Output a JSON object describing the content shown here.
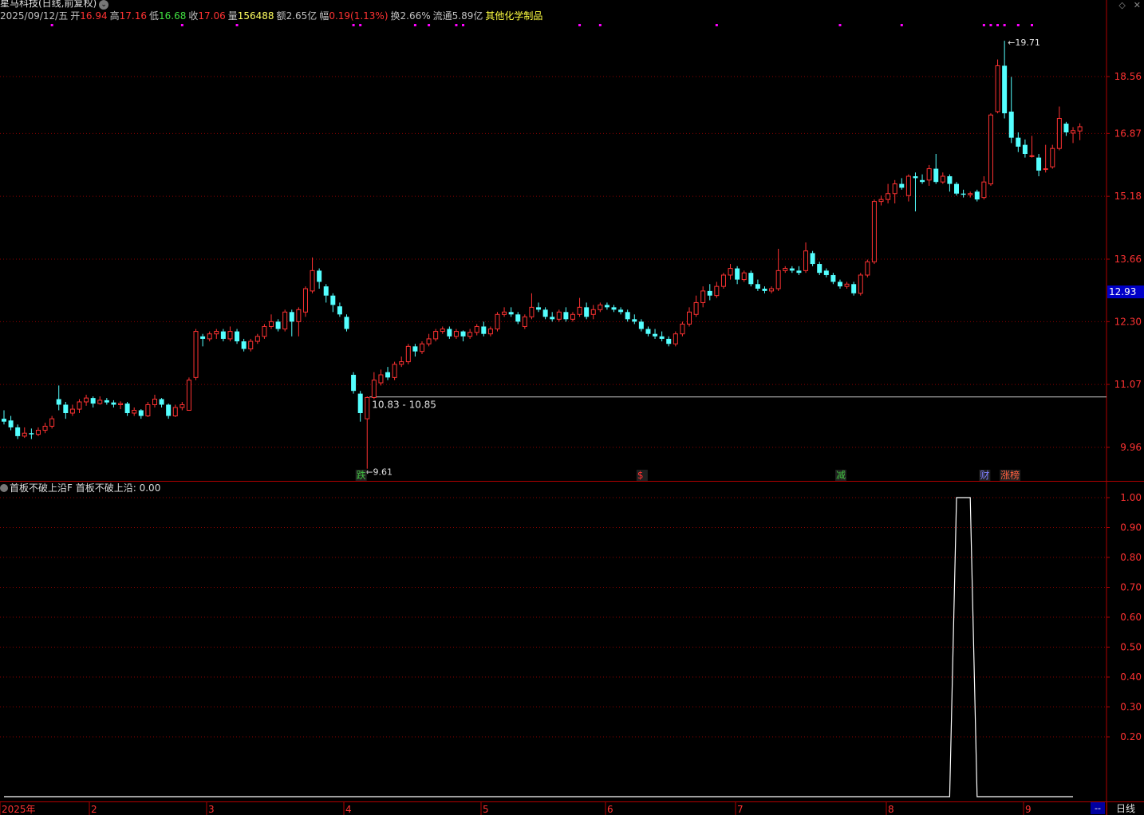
{
  "header": {
    "title": "星马科技(日线,前复权)",
    "date": "2025/09/12/五",
    "open_label": "开",
    "open": "16.94",
    "high_label": "高",
    "high": "17.16",
    "low_label": "低",
    "low": "16.68",
    "close_label": "收",
    "close": "17.06",
    "volume_label": "量",
    "volume": "156488",
    "amount_label": "额",
    "amount": "2.65亿",
    "change_label": "幅",
    "change": "0.19(1.13%)",
    "turnover_label": "换",
    "turnover": "2.66%",
    "float_label": "流通",
    "float": "5.89亿",
    "industry": "其他化学制品"
  },
  "window_icons": [
    "diamond-icon",
    "close-icon"
  ],
  "indicator": {
    "name": "首板不破上沿F",
    "value_label": "首板不破上沿:",
    "value": "0.00"
  },
  "period_tab": "日线",
  "period_dash": "--",
  "colors": {
    "up": "#ff3232",
    "down": "#54ffff",
    "grid": "#8b0000",
    "axis_text": "#ff3232",
    "current_price_bg": "#0000c8",
    "indicator_line": "#ffffff",
    "marker": "#ff00ff"
  },
  "chart_data": [
    {
      "type": "candlestick",
      "y_ticks": [
        "18.56",
        "16.87",
        "15.18",
        "13.66",
        "12.30",
        "11.07",
        "9.96"
      ],
      "current_price": "12.93",
      "high_annotation": "19.71",
      "low_annotation": "9.61",
      "range_annotation": "10.83 - 10.85",
      "x_ticks": [
        "2025年",
        "2",
        "3",
        "4",
        "5",
        "6",
        "7",
        "8",
        "9"
      ],
      "event_tags": [
        {
          "text": "跌",
          "color": "#40c040"
        },
        {
          "text": "$",
          "color": "#ff3232"
        },
        {
          "text": "减",
          "color": "#40c040"
        },
        {
          "text": "财",
          "color": "#8080ff"
        },
        {
          "text": "涨榜",
          "color": "#ff6040"
        }
      ],
      "candles": [
        [
          10.45,
          10.4,
          10.6,
          10.35
        ],
        [
          10.42,
          10.3,
          10.5,
          10.25
        ],
        [
          10.3,
          10.15,
          10.35,
          10.1
        ],
        [
          10.15,
          10.2,
          10.3,
          10.12
        ],
        [
          10.2,
          10.18,
          10.28,
          10.1
        ],
        [
          10.18,
          10.25,
          10.3,
          10.15
        ],
        [
          10.25,
          10.32,
          10.38,
          10.2
        ],
        [
          10.32,
          10.45,
          10.5,
          10.28
        ],
        [
          10.8,
          10.7,
          11.05,
          10.6
        ],
        [
          10.7,
          10.55,
          10.75,
          10.45
        ],
        [
          10.55,
          10.62,
          10.7,
          10.5
        ],
        [
          10.62,
          10.75,
          10.8,
          10.55
        ],
        [
          10.75,
          10.82,
          10.88,
          10.68
        ],
        [
          10.82,
          10.72,
          10.85,
          10.65
        ],
        [
          10.72,
          10.78,
          10.85,
          10.7
        ],
        [
          10.78,
          10.74,
          10.82,
          10.7
        ],
        [
          10.74,
          10.7,
          10.78,
          10.65
        ],
        [
          10.7,
          10.72,
          10.76,
          10.62
        ],
        [
          10.72,
          10.55,
          10.75,
          10.5
        ],
        [
          10.55,
          10.6,
          10.65,
          10.5
        ],
        [
          10.6,
          10.5,
          10.62,
          10.45
        ],
        [
          10.5,
          10.7,
          10.75,
          10.48
        ],
        [
          10.7,
          10.8,
          10.88,
          10.65
        ],
        [
          10.8,
          10.7,
          10.82,
          10.65
        ],
        [
          10.7,
          10.5,
          10.72,
          10.45
        ],
        [
          10.5,
          10.65,
          10.7,
          10.48
        ],
        [
          10.65,
          10.7,
          10.75,
          10.6
        ],
        [
          10.6,
          11.15,
          11.2,
          10.6
        ],
        [
          11.2,
          12.1,
          12.15,
          11.15
        ],
        [
          12.0,
          11.95,
          12.05,
          11.8
        ],
        [
          11.95,
          12.05,
          12.1,
          11.9
        ],
        [
          12.05,
          12.1,
          12.15,
          11.95
        ],
        [
          12.1,
          11.95,
          12.15,
          11.9
        ],
        [
          11.95,
          12.1,
          12.2,
          11.9
        ],
        [
          12.1,
          11.9,
          12.15,
          11.85
        ],
        [
          11.9,
          11.75,
          11.95,
          11.7
        ],
        [
          11.75,
          11.9,
          11.95,
          11.7
        ],
        [
          11.9,
          12.0,
          12.05,
          11.85
        ],
        [
          12.0,
          12.2,
          12.25,
          11.95
        ],
        [
          12.2,
          12.3,
          12.45,
          12.15
        ],
        [
          12.3,
          12.15,
          12.35,
          12.1
        ],
        [
          12.15,
          12.5,
          12.55,
          12.1
        ],
        [
          12.5,
          12.3,
          12.55,
          12.0
        ],
        [
          12.3,
          12.55,
          12.6,
          12.0
        ],
        [
          12.5,
          13.0,
          13.05,
          12.4
        ],
        [
          12.95,
          13.4,
          13.7,
          12.9
        ],
        [
          13.4,
          13.15,
          13.45,
          13.0
        ],
        [
          13.05,
          12.85,
          13.1,
          12.7
        ],
        [
          12.85,
          12.65,
          12.9,
          12.5
        ],
        [
          12.62,
          12.45,
          12.7,
          12.4
        ],
        [
          12.4,
          12.15,
          12.45,
          12.1
        ],
        [
          11.25,
          10.95,
          11.3,
          10.9
        ],
        [
          10.9,
          10.55,
          10.95,
          10.4
        ],
        [
          10.45,
          10.83,
          10.85,
          9.61
        ],
        [
          10.83,
          11.15,
          11.3,
          10.8
        ],
        [
          11.1,
          11.25,
          11.35,
          11.05
        ],
        [
          11.3,
          11.2,
          11.4,
          11.15
        ],
        [
          11.2,
          11.45,
          11.5,
          11.15
        ],
        [
          11.45,
          11.5,
          11.6,
          11.4
        ],
        [
          11.5,
          11.8,
          11.85,
          11.45
        ],
        [
          11.8,
          11.7,
          11.85,
          11.6
        ],
        [
          11.7,
          11.85,
          11.9,
          11.65
        ],
        [
          11.85,
          11.95,
          12.05,
          11.8
        ],
        [
          11.95,
          12.1,
          12.15,
          11.9
        ],
        [
          12.1,
          12.15,
          12.2,
          12.05
        ],
        [
          12.15,
          12.0,
          12.2,
          11.95
        ],
        [
          12.0,
          12.1,
          12.15,
          11.95
        ],
        [
          12.1,
          12.0,
          12.12,
          11.9
        ],
        [
          12.0,
          12.08,
          12.15,
          11.95
        ],
        [
          12.08,
          12.2,
          12.25,
          12.02
        ],
        [
          12.2,
          12.05,
          12.3,
          12.0
        ],
        [
          12.05,
          12.15,
          12.2,
          12.0
        ],
        [
          12.15,
          12.45,
          12.5,
          12.1
        ],
        [
          12.45,
          12.5,
          12.6,
          12.4
        ],
        [
          12.5,
          12.45,
          12.6,
          12.4
        ],
        [
          12.45,
          12.3,
          12.5,
          12.25
        ],
        [
          12.2,
          12.4,
          12.45,
          12.15
        ],
        [
          12.4,
          12.6,
          12.9,
          12.35
        ],
        [
          12.6,
          12.55,
          12.7,
          12.5
        ],
        [
          12.55,
          12.4,
          12.6,
          12.35
        ],
        [
          12.4,
          12.35,
          12.5,
          12.3
        ],
        [
          12.35,
          12.5,
          12.55,
          12.3
        ],
        [
          12.5,
          12.35,
          12.6,
          12.3
        ],
        [
          12.35,
          12.45,
          12.5,
          12.3
        ],
        [
          12.45,
          12.6,
          12.8,
          12.4
        ],
        [
          12.6,
          12.4,
          12.7,
          12.35
        ],
        [
          12.45,
          12.55,
          12.65,
          12.35
        ],
        [
          12.55,
          12.65,
          12.7,
          12.5
        ],
        [
          12.65,
          12.6,
          12.7,
          12.55
        ],
        [
          12.6,
          12.55,
          12.65,
          12.5
        ],
        [
          12.55,
          12.5,
          12.6,
          12.45
        ],
        [
          12.5,
          12.35,
          12.55,
          12.3
        ],
        [
          12.35,
          12.3,
          12.45,
          12.25
        ],
        [
          12.3,
          12.15,
          12.35,
          12.1
        ],
        [
          12.15,
          12.05,
          12.2,
          12.0
        ],
        [
          12.05,
          12.0,
          12.15,
          11.95
        ],
        [
          12.0,
          11.95,
          12.1,
          11.9
        ],
        [
          11.95,
          11.85,
          12.0,
          11.8
        ],
        [
          11.85,
          12.05,
          12.1,
          11.8
        ],
        [
          12.05,
          12.25,
          12.3,
          12.0
        ],
        [
          12.25,
          12.5,
          12.6,
          12.2
        ],
        [
          12.45,
          12.7,
          12.85,
          12.4
        ],
        [
          12.7,
          12.95,
          13.05,
          12.6
        ],
        [
          12.95,
          12.85,
          13.1,
          12.75
        ],
        [
          12.85,
          13.05,
          13.15,
          12.8
        ],
        [
          13.05,
          13.3,
          13.35,
          13.0
        ],
        [
          13.3,
          13.45,
          13.55,
          13.2
        ],
        [
          13.45,
          13.2,
          13.5,
          13.1
        ],
        [
          13.2,
          13.35,
          13.4,
          13.15
        ],
        [
          13.35,
          13.1,
          13.4,
          13.05
        ],
        [
          13.1,
          13.0,
          13.2,
          12.95
        ],
        [
          13.0,
          12.95,
          13.05,
          12.9
        ],
        [
          12.95,
          13.0,
          13.05,
          12.9
        ],
        [
          13.0,
          13.4,
          13.9,
          12.95
        ],
        [
          13.4,
          13.45,
          13.5,
          13.35
        ],
        [
          13.45,
          13.4,
          13.5,
          13.35
        ],
        [
          13.4,
          13.35,
          13.5,
          13.3
        ],
        [
          13.4,
          13.85,
          14.05,
          13.35
        ],
        [
          13.8,
          13.55,
          13.85,
          13.5
        ],
        [
          13.55,
          13.35,
          13.6,
          13.3
        ],
        [
          13.4,
          13.3,
          13.45,
          13.25
        ],
        [
          13.3,
          13.15,
          13.35,
          13.1
        ],
        [
          13.15,
          13.05,
          13.2,
          13.0
        ],
        [
          13.05,
          13.1,
          13.15,
          13.0
        ],
        [
          13.1,
          12.9,
          13.15,
          12.85
        ],
        [
          12.9,
          13.3,
          13.35,
          12.85
        ],
        [
          13.3,
          13.6,
          13.65,
          13.25
        ],
        [
          13.6,
          15.05,
          15.1,
          13.55
        ],
        [
          15.05,
          15.1,
          15.2,
          14.95
        ],
        [
          15.1,
          15.25,
          15.5,
          15.0
        ],
        [
          15.25,
          15.5,
          15.6,
          15.0
        ],
        [
          15.5,
          15.4,
          15.65,
          15.35
        ],
        [
          15.2,
          15.7,
          15.75,
          15.05
        ],
        [
          15.7,
          15.65,
          15.8,
          14.8
        ],
        [
          15.6,
          15.55,
          15.75,
          15.5
        ],
        [
          15.6,
          15.9,
          16.0,
          15.45
        ],
        [
          15.9,
          15.55,
          16.3,
          15.5
        ],
        [
          15.55,
          15.7,
          15.8,
          15.5
        ],
        [
          15.7,
          15.5,
          15.75,
          15.3
        ],
        [
          15.5,
          15.25,
          15.55,
          15.2
        ],
        [
          15.25,
          15.22,
          15.35,
          15.15
        ],
        [
          15.22,
          15.25,
          15.3,
          15.15
        ],
        [
          15.3,
          15.1,
          15.35,
          15.05
        ],
        [
          15.15,
          15.55,
          15.7,
          15.1
        ],
        [
          15.5,
          17.4,
          17.45,
          15.45
        ],
        [
          17.5,
          18.9,
          19.1,
          17.45
        ],
        [
          18.9,
          17.45,
          19.71,
          17.3
        ],
        [
          17.5,
          16.75,
          18.55,
          16.6
        ],
        [
          16.75,
          16.5,
          16.9,
          16.35
        ],
        [
          16.55,
          16.3,
          16.7,
          16.2
        ],
        [
          16.25,
          16.25,
          16.8,
          16.2
        ],
        [
          16.2,
          15.85,
          16.3,
          15.7
        ],
        [
          15.9,
          15.9,
          16.55,
          15.8
        ],
        [
          15.95,
          16.45,
          16.55,
          15.9
        ],
        [
          16.45,
          17.3,
          17.65,
          16.4
        ],
        [
          17.15,
          16.9,
          17.2,
          16.8
        ],
        [
          16.88,
          16.95,
          17.05,
          16.6
        ],
        [
          16.94,
          17.06,
          17.16,
          16.68
        ]
      ]
    },
    {
      "type": "line",
      "name": "首板不破上沿",
      "y_ticks": [
        "1.00",
        "0.90",
        "0.80",
        "0.70",
        "0.60",
        "0.50",
        "0.40",
        "0.30",
        "0.20"
      ],
      "x_start": 0,
      "x_end": 156,
      "ones": [
        139,
        140,
        141
      ]
    }
  ]
}
